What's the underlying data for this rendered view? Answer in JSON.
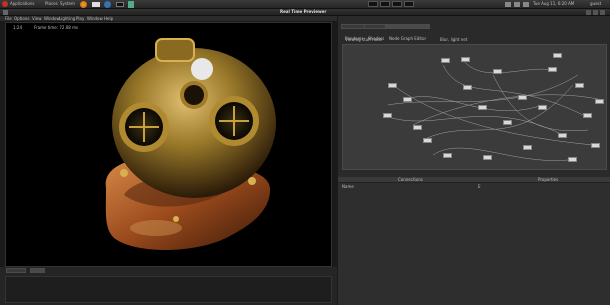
{
  "panel": {
    "menus": [
      "Applications",
      "Places",
      "System"
    ],
    "clock": "Tue Aug 11, 6:20 AM",
    "user": "guest"
  },
  "window": {
    "title": "Real Time Previewer"
  },
  "menubar": {
    "items": [
      "File",
      "Options",
      "View",
      "Window",
      "Lighting",
      "Play",
      "Window",
      "Help"
    ]
  },
  "viewer": {
    "info_left": "1:24",
    "info_mid": "Frame time: 72.08 ms"
  },
  "right_tabs": [
    "Renderer",
    "Shaders",
    "Node Graph Editor"
  ],
  "graph_labels": {
    "left": "Viewing stuff node",
    "right": "Blur, light net"
  },
  "table": {
    "col1": "Connections",
    "col2": "Properties",
    "row_label": "Name",
    "row_value": "E"
  },
  "bottom": {
    "tab1": "Script",
    "tab2": "Log"
  },
  "colors": {
    "background": "#1a1a1a",
    "viewer_bg": "#000000",
    "graph_bg": "#3b3b3b",
    "node": "#d9d9d9",
    "brass": "#b0882e",
    "copper": "#a45a2a"
  }
}
